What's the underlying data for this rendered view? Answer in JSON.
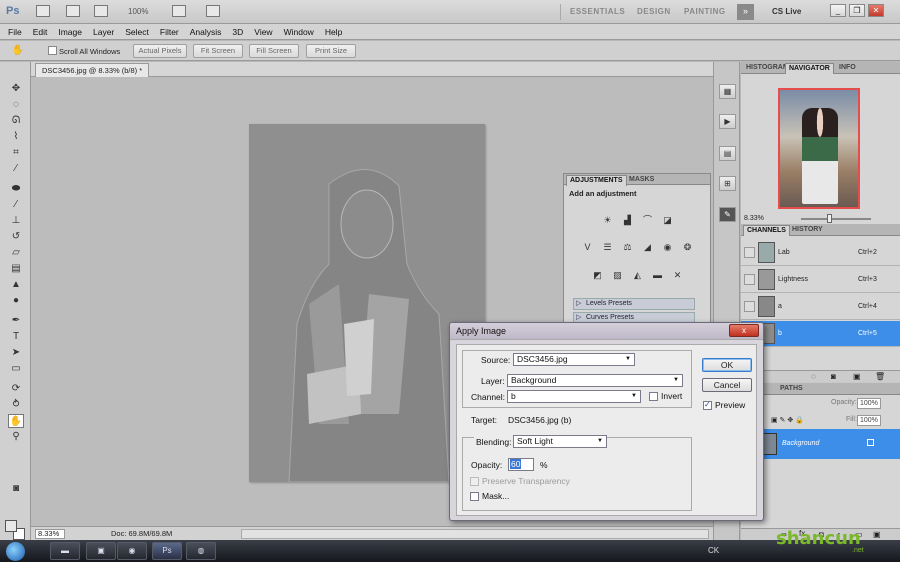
{
  "app": {
    "logo": "Ps",
    "zoom_level": "100%",
    "workspaces": [
      "ESSENTIALS",
      "DESIGN",
      "PAINTING"
    ],
    "more": "»",
    "cslive": "CS Live"
  },
  "menu": [
    "File",
    "Edit",
    "Image",
    "Layer",
    "Select",
    "Filter",
    "Analysis",
    "3D",
    "View",
    "Window",
    "Help"
  ],
  "options": {
    "scroll_all": "Scroll All Windows",
    "buttons": [
      "Actual Pixels",
      "Fit Screen",
      "Fill Screen",
      "Print Size"
    ]
  },
  "document": {
    "tab_title": "DSC3456.jpg @ 8.33% (b/8) *",
    "zoom": "8.33%",
    "doc_size": "Doc: 69.8M/69.8M"
  },
  "navigator": {
    "tabs": [
      "HISTOGRAM",
      "NAVIGATOR",
      "INFO"
    ],
    "zoom": "8.33%"
  },
  "channels": {
    "tabs": [
      "CHANNELS",
      "HISTORY"
    ],
    "rows": [
      {
        "name": "Lab",
        "key": "Ctrl+2"
      },
      {
        "name": "Lightness",
        "key": "Ctrl+3"
      },
      {
        "name": "a",
        "key": "Ctrl+4"
      },
      {
        "name": "b",
        "key": "Ctrl+5"
      }
    ]
  },
  "layers": {
    "tabs": [
      "PATHS"
    ],
    "opacity_label": "Opacity:",
    "opacity": "100%",
    "fill_label": "Fill:",
    "fill": "100%",
    "layer_name": "Background"
  },
  "adjustments": {
    "tabs": [
      "ADJUSTMENTS",
      "MASKS"
    ],
    "title": "Add an adjustment",
    "presets": [
      "Levels Presets",
      "Curves Presets"
    ]
  },
  "dialog": {
    "title": "Apply Image",
    "close": "x",
    "source_label": "Source:",
    "source": "DSC3456.jpg",
    "layer_label": "Layer:",
    "layer": "Background",
    "channel_label": "Channel:",
    "channel": "b",
    "invert": "Invert",
    "target_label": "Target:",
    "target": "DSC3456.jpg (b)",
    "blending_label": "Blending:",
    "blending": "Soft Light",
    "opacity_label": "Opacity:",
    "opacity": "60",
    "opacity_unit": "%",
    "preserve": "Preserve Transparency",
    "mask": "Mask...",
    "ok": "OK",
    "cancel": "Cancel",
    "preview": "Preview"
  },
  "taskbar": {
    "tray": "CK"
  },
  "watermark": {
    "main": "shancun",
    "sub": ".net"
  }
}
